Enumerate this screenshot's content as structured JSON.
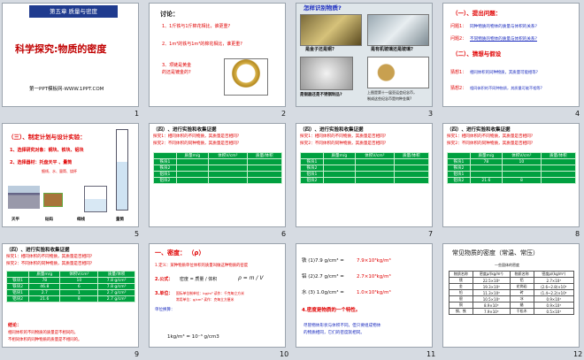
{
  "slides": [
    {
      "num": "1",
      "chapter": "第五章 质量与密度",
      "title": "科学探究:物质的密度",
      "footer": "第一PPT模板网-WWW.1PPT.COM"
    },
    {
      "num": "2",
      "label": "讨论：",
      "q1": "1、1斤铁与1斤棉花相比，谁更重?",
      "q2": "2、1m³的铁与1m³的棉花相比，谁更重?",
      "q3a": "3、项链是黄金",
      "q3b": "的还是镀金的?"
    },
    {
      "num": "3",
      "title": "怎样识别物质?",
      "cap1": "是金子还是铜?",
      "cap2": "是有机玻璃还是玻璃?",
      "cap3": "是银器还是不锈钢制品?",
      "cap4": "上图是第十一届亚运会纪念币，",
      "cap5": "制成这些纪念币是何种金属?"
    },
    {
      "num": "4",
      "h1": "（一）、提出问题：",
      "p1k": "问题1：",
      "p1": "同种物质的物体的质量与体积的关系?",
      "p2k": "问题2：",
      "p2": "不同物质的物体的质量与体积的关系?",
      "h2": "（二）、猜想与假设",
      "g1k": "猜想1：",
      "g1": "相同体积的同种物质，其质量可能相等?",
      "g2k": "猜想2：",
      "g2": "相同体积的不同种物质，其质量可能不相等?"
    },
    {
      "num": "5",
      "h": "（三）、制定计划与设计实验：",
      "s1": "1、选择研究对象：铜块、铁块、铝块",
      "s2": "2、选择器材：托盘天平 、量筒",
      "s2b": "细线、水、量筒、烧杯",
      "lab1": "天平",
      "lab2": "砝码",
      "lab3": "细线",
      "lab4": "量筒"
    },
    {
      "num": "6",
      "h": "（四）、进行实验和收集证据",
      "e1": "探究1：相同体积的不同物质，其质量是否相同?",
      "e2": "探究2：不同体积的同种物质，其质量是否相同?",
      "cols": [
        "",
        "质量m/g",
        "体积V/cm³",
        "质量/体积"
      ],
      "rows": [
        [
          "铁块1",
          "",
          "",
          ""
        ],
        [
          "铁块2",
          "",
          "",
          ""
        ],
        [
          "铝块1",
          "",
          "",
          ""
        ],
        [
          "铝块2",
          "",
          "",
          ""
        ]
      ]
    },
    {
      "num": "7",
      "h": "（四）、进行实验和收集证据",
      "e1": "探究1：相同体积的不同物质，其质量是否相同?",
      "e2": "探究2：不同体积的同种物质，其质量是否相同?",
      "cols": [
        "",
        "质量m/g",
        "体积V/cm³",
        "质量/体积"
      ],
      "rows": [
        [
          "铁块1",
          "",
          "",
          ""
        ],
        [
          "铁块2",
          "",
          "",
          ""
        ],
        [
          "铝块1",
          "",
          "",
          ""
        ],
        [
          "铝块2",
          "",
          "",
          ""
        ]
      ]
    },
    {
      "num": "8",
      "h": "（四）、进行实验和收集证据",
      "e1": "探究1：相同体积的不同物质，其质量是否相同?",
      "e2": "探究2：不同体积的同种物质，其质量是否相同?",
      "cols": [
        "",
        "质量m/g",
        "体积V/cm³",
        "质量/体积"
      ],
      "rows": [
        [
          "铁块1",
          "78",
          "10",
          ""
        ],
        [
          "铁块2",
          "",
          "",
          ""
        ],
        [
          "铝块1",
          "",
          "",
          ""
        ],
        [
          "铝块2",
          "21.6",
          "8",
          ""
        ]
      ]
    },
    {
      "num": "9",
      "h": "（四）、进行实验和收集证据",
      "e1": "探究1：相同体积的不同物质，其质量是否相同?",
      "e2": "探究2：不同体积的同种物质，其质量是否相同?",
      "cols": [
        "",
        "质量m/g",
        "体积V/cm³",
        "质量/体积"
      ],
      "rows": [
        [
          "铁块1",
          "78",
          "10",
          "7.8 g/cm³"
        ],
        [
          "铁块2",
          "46.8",
          "6",
          "7.8 g/cm³"
        ],
        [
          "铝块1",
          "2.7",
          "1",
          "2.7 g/cm³"
        ],
        [
          "铝块2",
          "21.6",
          "8",
          "2.7 g/cm³"
        ]
      ],
      "c": "结论：",
      "c1": "相同体积的不同物质的质量是不相同的。",
      "c2": "不相同体积的同种物质的质量是不相同的。"
    },
    {
      "num": "10",
      "h": "一、密度：  （ρ）",
      "d1": "1.定义：某种物质单位体积的质量叫做这种物质的密度",
      "d2": "2.公式：",
      "d2b": "密度 = 质量 / 体积",
      "d2c": "ρ = m / V",
      "d3": "3.单位：",
      "d3a": "国际单位制单位：kg/m³  读作：千克每立方米",
      "d3b": "常用单位：g/cm³  读作：克每立方厘米",
      "d4": "单位换算：",
      "d5": "1kg/m³ = 10⁻³ g/cm3"
    },
    {
      "num": "11",
      "l1": "铁 (1)7.9 g/cm³ = ",
      "l1r": "7.9×10³kg/m³",
      "l2": "铝 (2)2.7 g/cm³ = ",
      "l2r": "2.7×10³kg/m³",
      "l3": "水 (3) 1.0g/cm³ = ",
      "l3r": "1.0×10³kg/m³",
      "l4": "4.密度是物质的一个特性。",
      "l5a": "尽管物体形状与体积不同，但只要组成物体",
      "l5b": "的物质相同，它们的密度就相同。"
    },
    {
      "num": "12",
      "title": "常见物质的密度（常温、常压）",
      "sub": "一些固体的密度",
      "cols": [
        "物质名称",
        "密度ρ/(kg/m³)",
        "物质名称",
        "密度ρ/(kg/m³)"
      ],
      "rows": [
        [
          "锇",
          "22.5×10³",
          "铝",
          "2.7×10³"
        ],
        [
          "金",
          "19.3×10³",
          "花岗岩",
          "(2.6~2.8)×10³"
        ],
        [
          "铅",
          "11.3×10³",
          "砖",
          "(1.4~2.2)×10³"
        ],
        [
          "银",
          "10.5×10³",
          "冰",
          "0.9×10³"
        ],
        [
          "铜",
          "8.9×10³",
          "蜡",
          "0.9×10³"
        ],
        [
          "钢、铁",
          "7.9×10³",
          "干松木",
          "0.5×10³"
        ]
      ]
    }
  ]
}
